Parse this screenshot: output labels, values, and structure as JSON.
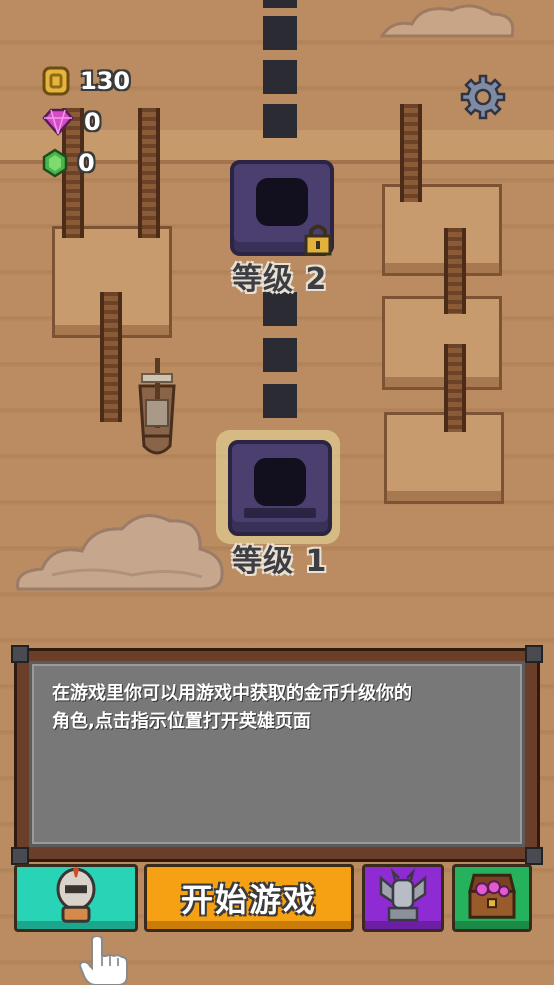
{
  "hud": {
    "coins": "130",
    "gems": "0",
    "emeralds": "0"
  },
  "levels": [
    {
      "label": "等级 2",
      "locked": true
    },
    {
      "label": "等级 1",
      "locked": false
    }
  ],
  "dialog": {
    "line1": "在游戏里你可以用游戏中获取的金币升级你的",
    "line2": "角色,点击指示位置打开英雄页面"
  },
  "bottom_bar": {
    "start_label": "开始游戏"
  },
  "colors": {
    "hero_button": "#28d3b6",
    "start_button": "#f6a114",
    "statue_button": "#8e2bd2",
    "shop_button": "#25b25c",
    "level_node": "#4a3f6e"
  },
  "icons": {
    "coin": "coin-icon",
    "gem": "pink-gem-icon",
    "emerald": "green-gem-icon",
    "settings": "gear-icon",
    "lock": "lock-icon",
    "hero": "knight-helmet-icon",
    "statue": "gargoyle-statue-icon",
    "shop": "treasure-chest-icon",
    "pointer": "pointing-hand-icon"
  }
}
